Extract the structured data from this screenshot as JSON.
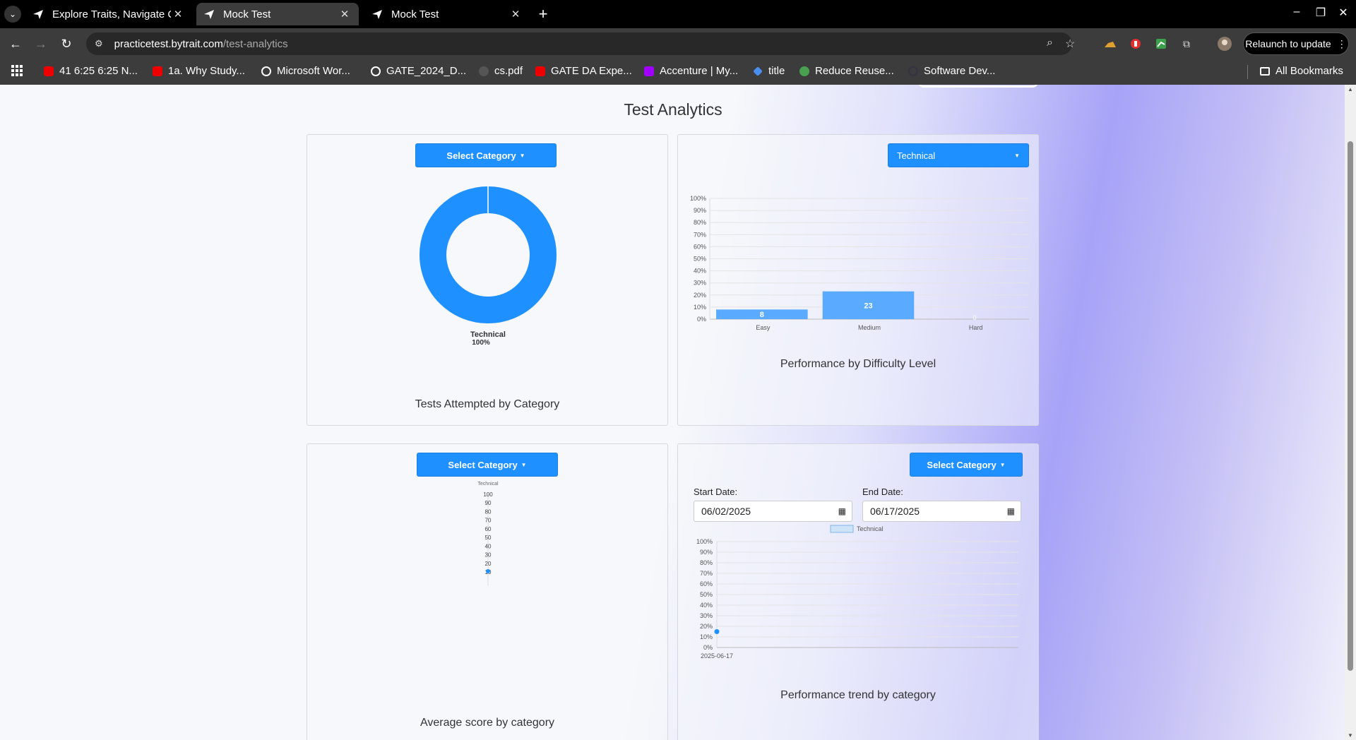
{
  "browser": {
    "tabs": [
      {
        "title": "Explore Traits, Navigate C"
      },
      {
        "title": "Mock Test"
      },
      {
        "title": "Mock Test"
      }
    ],
    "address": {
      "site": "practicetest.bytrait.com",
      "path": "/test-analytics"
    },
    "relaunch_label": "Relaunch to update",
    "bookmarks": [
      {
        "label": "41 6:25 6:25 N...",
        "icon": "youtube-icon"
      },
      {
        "label": "1a. Why Study...",
        "icon": "youtube-icon"
      },
      {
        "label": "Microsoft Wor...",
        "icon": "globe-icon"
      },
      {
        "label": "GATE_2024_D...",
        "icon": "globe-icon"
      },
      {
        "label": "cs.pdf",
        "icon": "pdf-icon"
      },
      {
        "label": "GATE DA Expe...",
        "icon": "youtube-icon"
      },
      {
        "label": "Accenture | My...",
        "icon": "accenture-icon"
      },
      {
        "label": "title",
        "icon": "diamond-icon"
      },
      {
        "label": "Reduce Reuse...",
        "icon": "recycle-icon"
      },
      {
        "label": "Software Dev...",
        "icon": "circle-icon"
      }
    ],
    "all_bookmarks_label": "All Bookmarks"
  },
  "page": {
    "title": "Test Analytics",
    "card1": {
      "button": "Select Category",
      "caption": "Tests Attempted by Category"
    },
    "card2": {
      "dropdown": "Technical",
      "caption": "Performance by Difficulty Level"
    },
    "card3": {
      "button": "Select Category",
      "caption": "Average score by category"
    },
    "card4": {
      "button": "Select Category",
      "start_label": "Start Date:",
      "start_value": "06/02/2025",
      "end_label": "End Date:",
      "end_value": "06/17/2025",
      "caption": "Performance trend by category"
    }
  },
  "chart_data": [
    {
      "type": "pie",
      "variant": "doughnut",
      "labels": [
        "Technical"
      ],
      "values": [
        100
      ],
      "value_labels": [
        "100%"
      ],
      "colors": [
        "#1e90ff"
      ],
      "title": "Tests Attempted by Category"
    },
    {
      "type": "bar",
      "categories": [
        "Easy",
        "Medium",
        "Hard"
      ],
      "values": [
        8,
        23,
        0
      ],
      "ylim": [
        0,
        100
      ],
      "yticks": [
        "0%",
        "10%",
        "20%",
        "30%",
        "40%",
        "50%",
        "60%",
        "70%",
        "80%",
        "90%",
        "100%"
      ],
      "color": "#5aabff",
      "grid": true,
      "title": "Performance by Difficulty Level"
    },
    {
      "type": "scatter",
      "variant": "radar",
      "labels": [
        "Technical"
      ],
      "values": [
        10
      ],
      "rticks": [
        "10",
        "20",
        "30",
        "40",
        "50",
        "60",
        "70",
        "80",
        "90",
        "100"
      ],
      "rlim": [
        0,
        100
      ],
      "color": "#1e90ff",
      "title": "Average score by category"
    },
    {
      "type": "line",
      "x": [
        "2025-06-17"
      ],
      "series": [
        {
          "name": "Technical",
          "values": [
            15
          ]
        }
      ],
      "ylim": [
        0,
        100
      ],
      "yticks": [
        "0%",
        "10%",
        "20%",
        "30%",
        "40%",
        "50%",
        "60%",
        "70%",
        "80%",
        "90%",
        "100%"
      ],
      "legend": "top",
      "grid": true,
      "color": "#1e90ff",
      "title": "Performance trend by category"
    }
  ]
}
